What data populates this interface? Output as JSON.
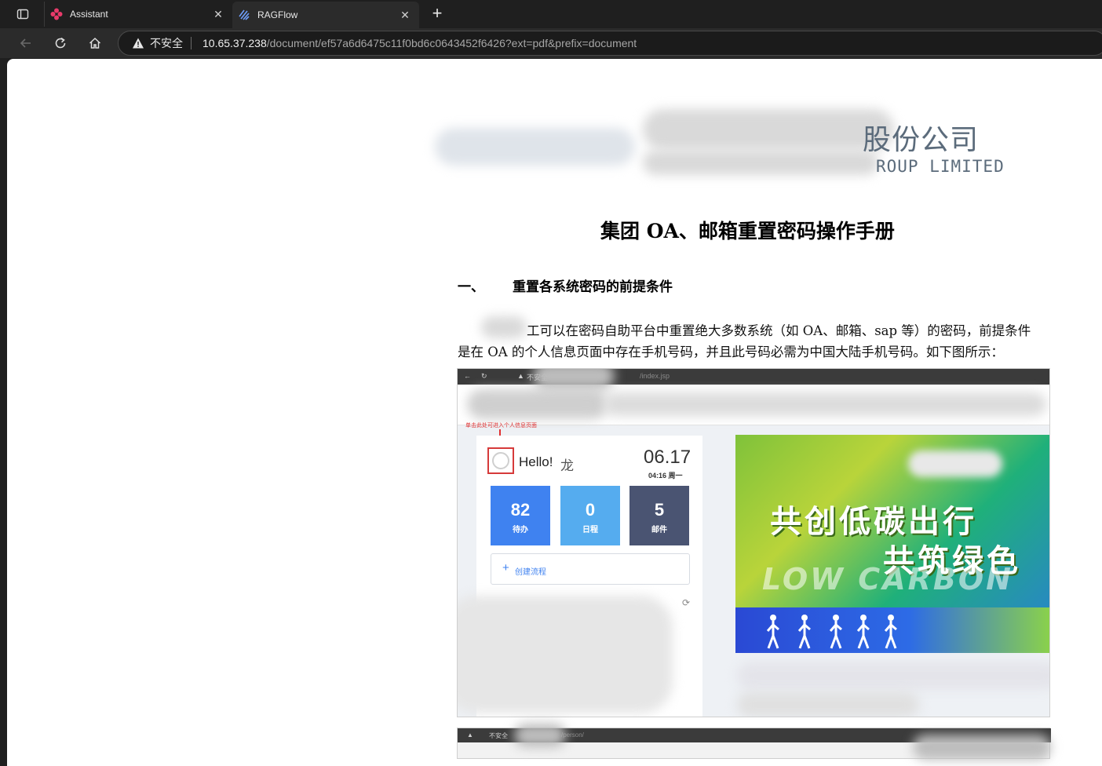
{
  "browser": {
    "tabs": [
      {
        "label": "Assistant",
        "active": false
      },
      {
        "label": "RAGFlow",
        "active": true
      }
    ],
    "address": {
      "security_label": "不安全",
      "host": "10.65.37.238",
      "path": "/document/ef57a6d6475c11f0bd6c0643452f6426?ext=pdf&prefix=document"
    }
  },
  "document": {
    "company_name_visible": "股份公司",
    "company_en_visible": "ROUP LIMITED",
    "title": "集团 OA、邮箱重置密码操作手册",
    "section_number": "一、",
    "section_title": "重置各系统密码的前提条件",
    "paragraph_line1": "工可以在密码自助平台中重置绝大多数系统（如 OA、邮箱、sap 等）的密码，前提条件",
    "paragraph_line2": "是在 OA 的个人信息页面中存在手机号码，并且此号码必需为中国大陆手机号码。如下图所示："
  },
  "screenshot": {
    "insecure_label": "不安全",
    "url_fragment": "/index.jsp",
    "hint": "单击此处可进入个人信息页面",
    "greeting": "Hello!",
    "user_name_visible": "龙",
    "date": "06.17",
    "time_weekday": "04:16 周一",
    "stats": [
      {
        "value": "82",
        "label": "待办"
      },
      {
        "value": "0",
        "label": "日程"
      },
      {
        "value": "5",
        "label": "邮件"
      }
    ],
    "create_label": "创建流程",
    "banner_line1": "共创低碳出行",
    "banner_line2": "共筑绿色",
    "banner_en": "LOW CARBON",
    "second_shot_insecure": "不安全",
    "second_shot_url": "/person/"
  },
  "colors": {
    "todo": "#3f82f0",
    "schedule": "#55acef",
    "mail": "#4a5472",
    "highlight_red": "#d63a3a"
  }
}
